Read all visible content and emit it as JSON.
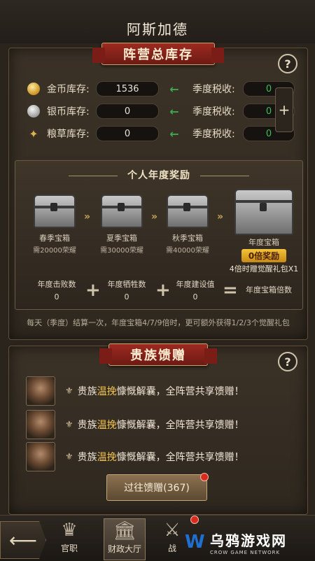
{
  "header": {
    "title": "阿斯加德"
  },
  "inventory": {
    "ribbon": "阵营总库存",
    "help": "?",
    "plus": "+",
    "rows": [
      {
        "icon": "gold-coin-icon",
        "label": "金币库存:",
        "value": "1536",
        "arrow": "←",
        "tax_label": "季度税收:",
        "tax": "0"
      },
      {
        "icon": "silver-coin-icon",
        "label": "银币库存:",
        "value": "0",
        "arrow": "←",
        "tax_label": "季度税收:",
        "tax": "0"
      },
      {
        "icon": "grain-icon",
        "label": "粮草库存:",
        "value": "0",
        "arrow": "←",
        "tax_label": "季度税收:",
        "tax": "0"
      }
    ]
  },
  "annual_rewards": {
    "title": "个人年度奖励",
    "chests": [
      {
        "name": "春季宝箱",
        "req": "需20000荣耀"
      },
      {
        "name": "夏季宝箱",
        "req": "需30000荣耀"
      },
      {
        "name": "秋季宝箱",
        "req": "需40000荣耀"
      }
    ],
    "annual_chest": {
      "name": "年度宝箱",
      "badge": "0倍奖励",
      "note": "4倍时赠觉醒礼包X1"
    },
    "formula": [
      {
        "label": "年度击败数",
        "value": "0"
      },
      {
        "label": "年度牺牲数",
        "value": "0"
      },
      {
        "label": "年度建设值",
        "value": "0"
      },
      {
        "label": "年度宝箱倍数",
        "value": ""
      }
    ],
    "ops": [
      "+",
      "+",
      "="
    ],
    "footnote": "每天（季度）结算一次，年度宝箱4/7/9倍时，更可额外获得1/2/3个觉醒礼包"
  },
  "noble_gifts": {
    "ribbon": "贵族馈赠",
    "help": "?",
    "items": [
      {
        "prefix": "贵族",
        "name": "温挽",
        "suffix": "慷慨解囊，全阵营共享馈赠！"
      },
      {
        "prefix": "贵族",
        "name": "温挽",
        "suffix": "慷慨解囊，全阵营共享馈赠！"
      },
      {
        "prefix": "贵族",
        "name": "温挽",
        "suffix": "慷慨解囊，全阵营共享馈赠！"
      }
    ],
    "history_button": "过往馈赠(367)"
  },
  "nav": {
    "back": "⟵",
    "items": [
      {
        "label": "官职",
        "icon": "crown-icon",
        "glyph": "♛"
      },
      {
        "label": "财政大厅",
        "icon": "treasury-hall-icon",
        "glyph": "🏛"
      },
      {
        "label": "战",
        "icon": "battle-icon",
        "glyph": "⚔"
      }
    ]
  },
  "watermark": {
    "text": "乌鸦游戏网",
    "sub": "CROW GAME NETWORK"
  }
}
